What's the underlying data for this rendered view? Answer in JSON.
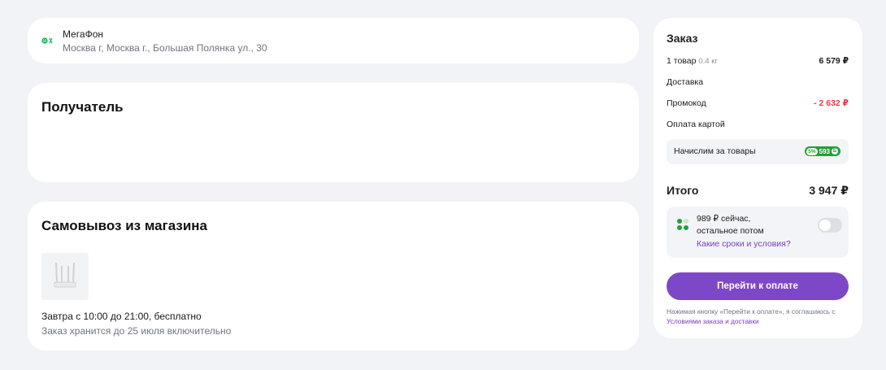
{
  "store": {
    "name": "МегаФон",
    "address": "Москва г, Москва г., Большая Полянка ул., 30",
    "icon": "megafon-logo-icon",
    "brand_color": "#00b956"
  },
  "recipient": {
    "title": "Получатель"
  },
  "pickup": {
    "title": "Самовывоз из магазина",
    "time": "Завтра с 10:00 до 21:00, бесплатно",
    "hold": "Заказ хранится до 25 июля включительно",
    "product_icon": "router-icon"
  },
  "order": {
    "title": "Заказ",
    "items_label": "1 товар",
    "items_weight": "0.4 кг",
    "items_price": "6 579 ₽",
    "delivery_label": "Доставка",
    "promo_label": "Промокод",
    "promo_value": "- 2 632 ₽",
    "card_payment_label": "Оплата картой",
    "bonus_label": "Начислим за товары",
    "bonus_percent": "5%",
    "bonus_amount": "593",
    "total_label": "Итого",
    "total_value": "3 947 ₽",
    "split_line1": "989 ₽ сейчас,",
    "split_line2": "остальное потом",
    "split_link": "Какие сроки и условия?",
    "split_toggle_on": false,
    "pay_button": "Перейти к оплате",
    "agreement_text": "Нажимая кнопку «Перейти к оплате», я соглашаюсь с",
    "agreement_link": "Условиями заказа и доставки"
  },
  "colors": {
    "accent": "#7d48c8",
    "discount": "#f2374b",
    "bonus": "#21a038",
    "background": "#f1f3f6"
  }
}
